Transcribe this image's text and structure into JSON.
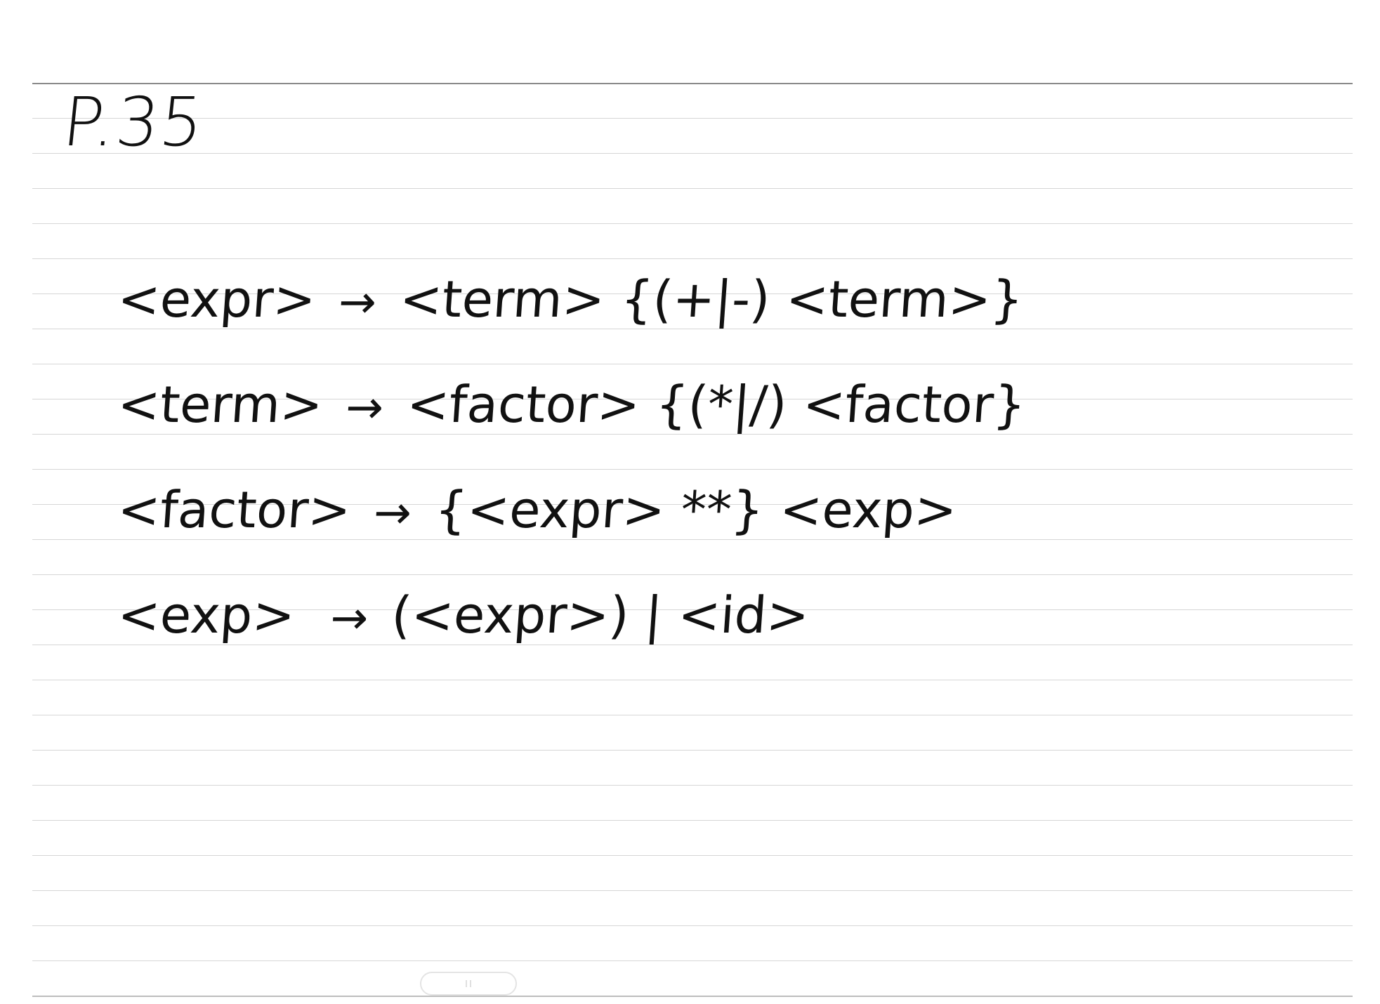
{
  "page": {
    "label": "P.35"
  },
  "grammar": {
    "arrow": "→",
    "rules": [
      {
        "lhs": "<expr>",
        "rhs": "<term> {(+|-) <term>}"
      },
      {
        "lhs": "<term>",
        "rhs": "<factor> {(*|/) <factor}"
      },
      {
        "lhs": "<factor>",
        "rhs": "{<expr> **} <exp>"
      },
      {
        "lhs": "<exp>",
        "rhs": "(<expr>) | <id>"
      }
    ]
  },
  "colors": {
    "ink": "#111111",
    "rule_line": "#d6d6d6",
    "top_rule": "#8a8a8a",
    "background": "#ffffff"
  }
}
